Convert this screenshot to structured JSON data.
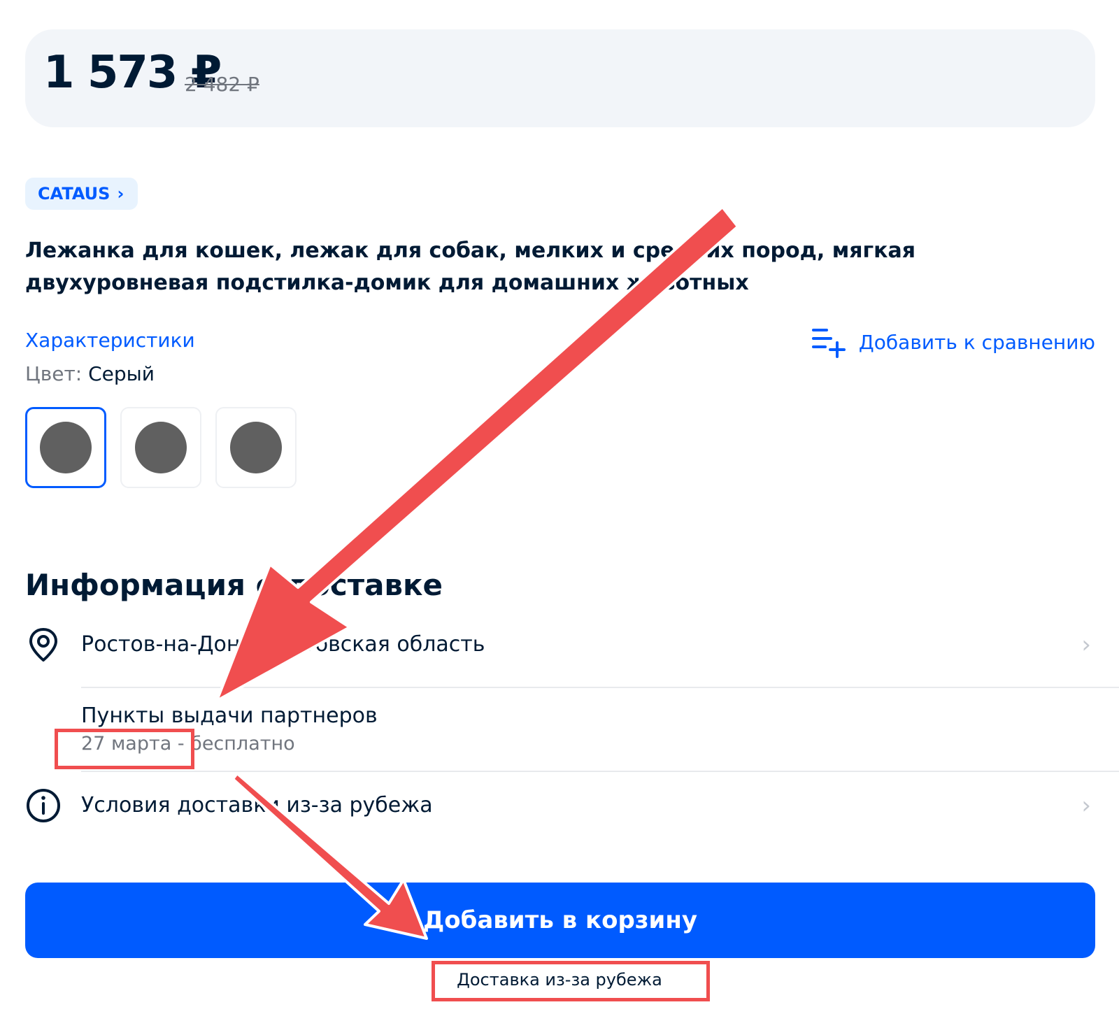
{
  "price": {
    "current": "1 573 ₽",
    "old": "2 482 ₽"
  },
  "brand": {
    "name": "CATAUS",
    "chevron": "›"
  },
  "product": {
    "title": "Лежанка для кошек, лежак для собак, мелких и средних пород, мягкая двухуровневая подстилка-домик для домашних животных"
  },
  "specs": {
    "link_label": "Характеристики",
    "compare_label": "Добавить к сравнению",
    "color_label": "Цвет:",
    "color_value": "Серый"
  },
  "swatches": [
    {
      "color": "#606060",
      "selected": true
    },
    {
      "color": "#606060",
      "selected": false
    },
    {
      "color": "#606060",
      "selected": false
    }
  ],
  "delivery": {
    "title": "Информация о доставке",
    "location": "Ростов-на-Дону, Ростовская область",
    "pickup_title": "Пункты выдачи партнеров",
    "pickup_date": "27 марта - бесплатно",
    "abroad_terms": "Условия доставки из-за рубежа"
  },
  "cart": {
    "button_label": "Добавить в корзину",
    "abroad_label": "Доставка из-за рубежа"
  },
  "icons": {
    "location": "location-pin-icon",
    "info": "info-icon",
    "compare": "compare-list-add-icon",
    "chevron": "chevron-right-icon"
  },
  "colors": {
    "accent": "#005bff",
    "annotation": "#f04e4f",
    "card_bg": "#f2f5f9"
  }
}
